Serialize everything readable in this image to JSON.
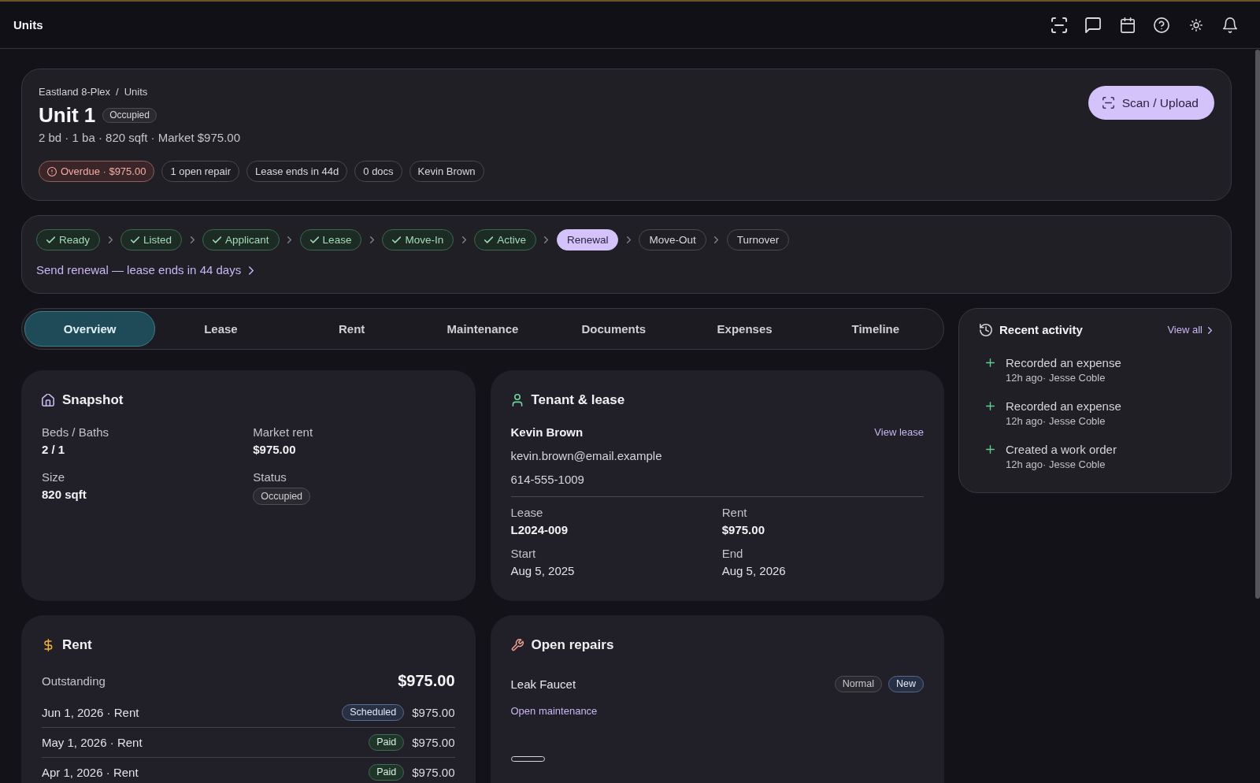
{
  "top_bar": {
    "title": "Units"
  },
  "header": {
    "breadcrumb": {
      "parent": "Eastland 8-Plex",
      "separator": "/",
      "current": "Units"
    },
    "title": "Unit 1",
    "status_badge": "Occupied",
    "summary": "2 bd · 1 ba · 820 sqft · Market $975.00",
    "chips": [
      {
        "label": "Overdue · $975.00",
        "kind": "alert"
      },
      {
        "label": "1 open repair",
        "kind": "plain"
      },
      {
        "label": "Lease ends in 44d",
        "kind": "plain"
      },
      {
        "label": "0 docs",
        "kind": "plain"
      },
      {
        "label": "Kevin Brown",
        "kind": "plain"
      }
    ],
    "action_button": {
      "label": "Scan / Upload"
    }
  },
  "pipeline": {
    "steps": [
      {
        "label": "Ready",
        "done": true,
        "selected": false
      },
      {
        "label": "Listed",
        "done": true,
        "selected": false
      },
      {
        "label": "Applicant",
        "done": true,
        "selected": false
      },
      {
        "label": "Lease",
        "done": true,
        "selected": false
      },
      {
        "label": "Move-In",
        "done": true,
        "selected": false
      },
      {
        "label": "Active",
        "done": true,
        "selected": false
      },
      {
        "label": "Renewal",
        "done": false,
        "selected": true
      },
      {
        "label": "Move-Out",
        "done": false,
        "selected": false
      },
      {
        "label": "Turnover",
        "done": false,
        "selected": false
      }
    ],
    "next_action": "Send renewal — lease ends in 44 days"
  },
  "tabs": [
    {
      "label": "Overview",
      "selected": true
    },
    {
      "label": "Lease",
      "selected": false
    },
    {
      "label": "Rent",
      "selected": false
    },
    {
      "label": "Maintenance",
      "selected": false
    },
    {
      "label": "Documents",
      "selected": false
    },
    {
      "label": "Expenses",
      "selected": false
    },
    {
      "label": "Timeline",
      "selected": false
    }
  ],
  "snapshot": {
    "title": "Snapshot",
    "fields": [
      {
        "label": "Beds / Baths",
        "value": "2 / 1",
        "kind": "text"
      },
      {
        "label": "Market rent",
        "value": "$975.00",
        "kind": "text"
      },
      {
        "label": "Size",
        "value": "820 sqft",
        "kind": "text"
      },
      {
        "label": "Status",
        "value": "Occupied",
        "kind": "badge"
      }
    ]
  },
  "tenant_lease": {
    "title": "Tenant & lease",
    "name": "Kevin Brown",
    "link": "View lease",
    "email": "kevin.brown@email.example",
    "phone": "614-555-1009",
    "fields": [
      {
        "label": "Lease",
        "value": "L2024-009",
        "kind": "strong"
      },
      {
        "label": "Rent",
        "value": "$975.00",
        "kind": "strong"
      },
      {
        "label": "Start",
        "value": "Aug 5, 2025",
        "kind": "plain"
      },
      {
        "label": "End",
        "value": "Aug 5, 2026",
        "kind": "plain"
      }
    ]
  },
  "rent": {
    "title": "Rent",
    "outstanding": {
      "label": "Outstanding",
      "value": "$975.00"
    },
    "payments": [
      {
        "description": "Jun 1, 2026 · Rent",
        "badge": "Scheduled",
        "kind": "scheduled",
        "amount": "$975.00"
      },
      {
        "description": "May 1, 2026 · Rent",
        "badge": "Paid",
        "kind": "paid",
        "amount": "$975.00"
      },
      {
        "description": "Apr 1, 2026 · Rent",
        "badge": "Paid",
        "kind": "paid",
        "amount": "$975.00"
      }
    ]
  },
  "open_repairs": {
    "title": "Open repairs",
    "items": [
      {
        "name": "Leak Faucet",
        "tags": [
          {
            "label": "Normal",
            "kind": "neutral"
          },
          {
            "label": "New",
            "kind": "info"
          }
        ]
      }
    ],
    "link": "Open maintenance"
  },
  "recent_activity": {
    "title": "Recent activity",
    "link": "View all",
    "items": [
      {
        "action": "Recorded an expense",
        "meta": "12h ago· Jesse Coble"
      },
      {
        "action": "Recorded an expense",
        "meta": "12h ago· Jesse Coble"
      },
      {
        "action": "Created a work order",
        "meta": "12h ago· Jesse Coble"
      }
    ]
  }
}
